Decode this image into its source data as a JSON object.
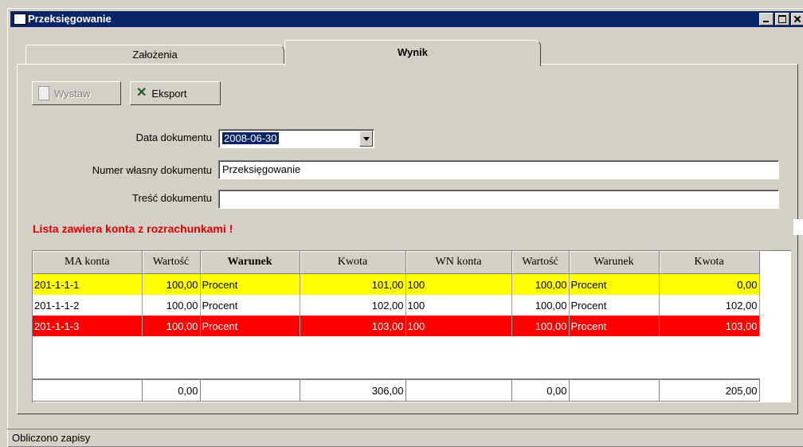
{
  "window": {
    "title": "Przeksięgowanie"
  },
  "tabs": [
    {
      "label": "Założenia"
    },
    {
      "label": "Wynik"
    }
  ],
  "toolbar": {
    "issue_label": "Wystaw",
    "export_label": "Eksport"
  },
  "form": {
    "date_label": "Data dokumentu",
    "date_value": "2008-06-30",
    "number_label": "Numer własny dokumentu",
    "number_value": "Przeksięgowanie",
    "content_label": "Treść dokumentu",
    "content_value": ""
  },
  "warning": "Lista zawiera konta z rozrachunkami !",
  "grid": {
    "columns": [
      "MA konta",
      "Wartość",
      "Warunek",
      "Kwota",
      "WN konta",
      "Wartość",
      "Warunek",
      "Kwota"
    ],
    "rows": [
      [
        "201-1-1-1",
        "100,00",
        "Procent",
        "101,00",
        "100",
        "100,00",
        "Procent",
        "0,00"
      ],
      [
        "201-1-1-2",
        "100,00",
        "Procent",
        "102,00",
        "100",
        "100,00",
        "Procent",
        "102,00"
      ],
      [
        "201-1-1-3",
        "100,00",
        "Procent",
        "103,00",
        "100",
        "100,00",
        "Procent",
        "103,00"
      ]
    ],
    "row_colors": [
      "#ffff00",
      "#ffffff",
      "#ff0000"
    ],
    "totals": [
      "",
      "0,00",
      "",
      "306,00",
      "",
      "0,00",
      "",
      "205,00"
    ]
  },
  "status": "Obliczono zapisy"
}
